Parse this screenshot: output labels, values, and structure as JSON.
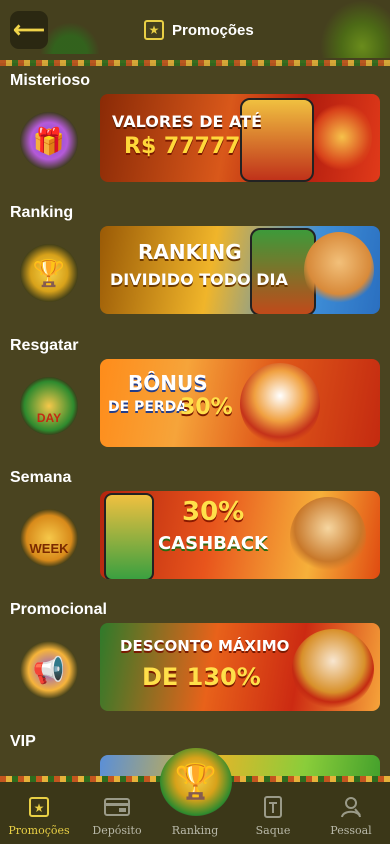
{
  "header": {
    "title": "Promoções",
    "back_icon": "arrow-left-icon",
    "title_icon": "star-card-icon"
  },
  "sections": [
    {
      "title": "Misterioso",
      "badge_icon": "gift-box-icon",
      "banner": {
        "line1": "VALORES DE ATÉ",
        "line2": "R$ 77777"
      }
    },
    {
      "title": "Ranking",
      "badge_icon": "trophy-icon",
      "banner": {
        "line1": "RANKING",
        "line2": "DIVIDIDO TODO DIA"
      }
    },
    {
      "title": "Resgatar",
      "badge_icon": "day-coins-icon",
      "badge_text": "DAY",
      "banner": {
        "line1": "BÔNUS",
        "line2": "DE PERDA",
        "line3": "30%"
      }
    },
    {
      "title": "Semana",
      "badge_icon": "week-coins-icon",
      "badge_text": "WEEK",
      "banner": {
        "line1": "30%",
        "line2": "CASHBACK"
      }
    },
    {
      "title": "Promocional",
      "badge_icon": "megaphone-icon",
      "banner": {
        "line1": "DESCONTO MÁXIMO",
        "line2": "DE 130%"
      }
    },
    {
      "title": "VIP",
      "badge_icon": "vip-icon",
      "banner": {
        "line1": "",
        "line2": ""
      }
    }
  ],
  "nav": {
    "items": [
      {
        "label": "Promoções",
        "icon": "star-card-icon",
        "active": true
      },
      {
        "label": "Depósito",
        "icon": "wallet-icon",
        "active": false
      },
      {
        "label": "Ranking",
        "icon": "trophy-icon",
        "active": false
      },
      {
        "label": "Saque",
        "icon": "withdraw-icon",
        "active": false
      },
      {
        "label": "Pessoal",
        "icon": "person-icon",
        "active": false
      }
    ]
  },
  "colors": {
    "background": "#4a4420",
    "accent": "#e8cf45",
    "nav_background": "#3b3718"
  }
}
